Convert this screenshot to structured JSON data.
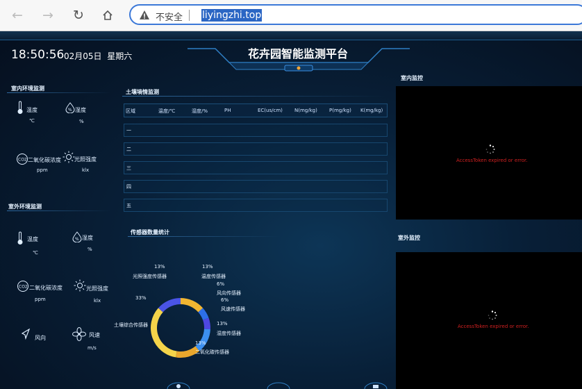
{
  "browser": {
    "security_label": "不安全",
    "url": "liyingzhi.top"
  },
  "header": {
    "time": "18:50:56",
    "date": "02月05日",
    "weekday": "星期六",
    "title": "花卉园智能监测平台"
  },
  "indoor_env": {
    "title": "室内环境监测",
    "temperature": {
      "label": "温度",
      "unit": "℃"
    },
    "humidity": {
      "label": "湿度",
      "unit": "%"
    },
    "co2": {
      "label": "二氧化碳浓度",
      "unit": "ppm"
    },
    "light": {
      "label": "光照强度",
      "unit": "klx"
    }
  },
  "outdoor_env": {
    "title": "室外环境监测",
    "temperature": {
      "label": "温度",
      "unit": "℃"
    },
    "humidity": {
      "label": "湿度",
      "unit": "%"
    },
    "co2": {
      "label": "二氧化碳浓度",
      "unit": "ppm"
    },
    "light": {
      "label": "光照强度",
      "unit": "klx"
    },
    "wind_dir": {
      "label": "风向"
    },
    "wind_speed": {
      "label": "风速",
      "unit": "m/s"
    }
  },
  "soil": {
    "title": "土壤墒情监测",
    "headers": [
      "区域",
      "温度/℃",
      "湿度/%",
      "PH",
      "EC(us/cm)",
      "N(mg/kg)",
      "P(mg/kg)",
      "K(mg/kg)"
    ],
    "rows": [
      "一",
      "二",
      "三",
      "四",
      "五"
    ]
  },
  "sensors": {
    "title": "传感器数量统计"
  },
  "chart_data": {
    "type": "pie",
    "donut": true,
    "title": "传感器数量统计",
    "slices": [
      {
        "label": "土壤综合传感器",
        "percent": "33%",
        "value": 33,
        "color": "#f4d44a"
      },
      {
        "label": "光照强度传感器",
        "percent": "13%",
        "value": 13,
        "color": "#4a54e6"
      },
      {
        "label": "温度传感器",
        "percent": "13%",
        "value": 13,
        "color": "#f2b631"
      },
      {
        "label": "风向传感器",
        "percent": "6%",
        "value": 6,
        "color": "#2d6fe8"
      },
      {
        "label": "风速传感器",
        "percent": "6%",
        "value": 6,
        "color": "#4f47e3"
      },
      {
        "label": "湿度传感器",
        "percent": "13%",
        "value": 13,
        "color": "#3c8ff0"
      },
      {
        "label": "二氧化碳传感器",
        "percent": "13%",
        "value": 13,
        "color": "#e9a72d"
      }
    ]
  },
  "indoor_cam": {
    "title": "室内监控",
    "error": "AccessToken expired or error."
  },
  "outdoor_cam": {
    "title": "室外监控",
    "error": "AccessToken expired or error."
  }
}
